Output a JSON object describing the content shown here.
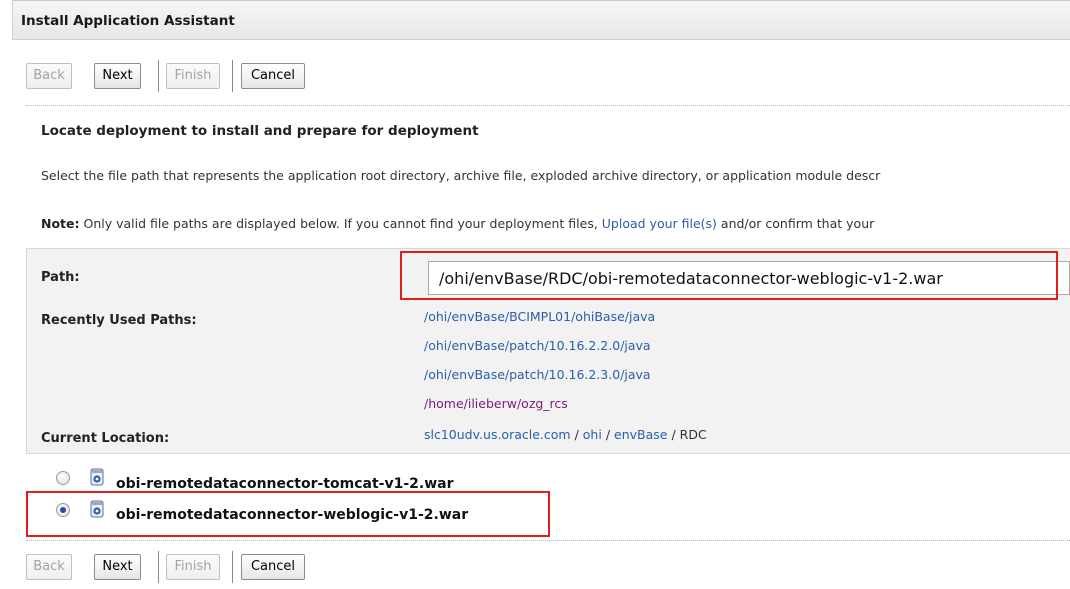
{
  "window": {
    "title": "Install Application Assistant"
  },
  "toolbar_top": {
    "back": "Back",
    "next": "Next",
    "finish": "Finish",
    "cancel": "Cancel"
  },
  "toolbar_bottom": {
    "back": "Back",
    "next": "Next",
    "finish": "Finish",
    "cancel": "Cancel"
  },
  "heading": "Locate deployment to install and prepare for deployment",
  "description": "Select the file path that represents the application root directory, archive file, exploded archive directory, or application module descr",
  "note": {
    "label": "Note:",
    "text_before": " Only valid file paths are displayed below. If you cannot find your deployment files, ",
    "link": "Upload your file(s)",
    "text_after": " and/or confirm that your"
  },
  "path": {
    "label": "Path:",
    "value": "/ohi/envBase/RDC/obi-remotedataconnector-weblogic-v1-2.war"
  },
  "recent": {
    "label": "Recently Used Paths:",
    "items": [
      "/ohi/envBase/BCIMPL01/ohiBase/java",
      "/ohi/envBase/patch/10.16.2.2.0/java",
      "/ohi/envBase/patch/10.16.2.3.0/java",
      "/home/ilieberw/ozg_rcs"
    ]
  },
  "location": {
    "label": "Current Location:",
    "host": "slc10udv.us.oracle.com",
    "sep": "/",
    "seg1": "ohi",
    "seg2": "envBase",
    "seg3": "RDC"
  },
  "files": [
    {
      "name": "obi-remotedataconnector-tomcat-v1-2.war",
      "selected": false
    },
    {
      "name": "obi-remotedataconnector-weblogic-v1-2.war",
      "selected": true
    }
  ],
  "colors": {
    "highlight": "#e11d1d",
    "link": "#2a5fa8",
    "visited": "#7b1c7b"
  }
}
